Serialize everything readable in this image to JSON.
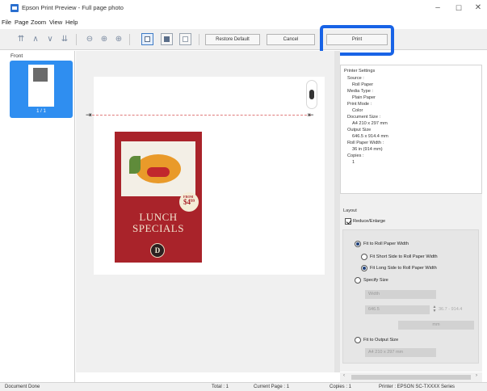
{
  "window": {
    "title": "Epson Print Preview - Full page photo",
    "controls": {
      "minimize": "–",
      "maximize": "☐",
      "close": "✕"
    }
  },
  "menu": {
    "items": [
      "File",
      "Page",
      "Zoom",
      "View",
      "Help"
    ]
  },
  "toolbar": {
    "icons": [
      "first-page-icon",
      "previous-page-icon",
      "next-page-icon",
      "last-page-icon",
      "zoom-out-icon",
      "zoom-actual-icon",
      "zoom-in-icon",
      "full-page-icon",
      "fit-width-icon",
      "blank-page-icon"
    ],
    "restore_default_label": "Restore Default",
    "cancel_label": "Cancel",
    "print_label": "Print"
  },
  "thumbnails": {
    "header": "Front",
    "page_label": "1 / 1"
  },
  "preview": {
    "poster": {
      "line1": "LUNCH",
      "line2": "SPECIALS",
      "price_prefix": "FROM",
      "price": "$4",
      "price_cents": "99",
      "logo_letter": "D"
    }
  },
  "printer_settings": {
    "header": "Printer Settings",
    "source_label": "Source :",
    "source_value": "Roll Paper",
    "media_type_label": "Media Type :",
    "media_type_value": "Plain Paper",
    "print_mode_label": "Print Mode :",
    "print_mode_value": "Color",
    "document_size_label": "Document Size :",
    "document_size_value": "A4 210 x 297 mm",
    "output_size_label": "Output Size",
    "output_size_value": "646.5 x 914.4 mm",
    "roll_width_label": "Roll Paper Width :",
    "roll_width_value": "36 in (914 mm)",
    "copies_label": "Copies :",
    "copies_value": "1"
  },
  "layout": {
    "header": "Layout",
    "reduce_enlarge_label": "Reduce/Enlarge",
    "fit_roll_width_label": "Fit to Roll Paper Width",
    "fit_short_side_label": "Fit Short Side to Roll Paper Width",
    "fit_long_side_label": "Fit Long Side to Roll Paper Width",
    "specify_size_label": "Specify Size",
    "width_field_label": "Width",
    "width_value": "646.5",
    "width_range": "36.7 - 914.4",
    "unit_value": "mm",
    "fit_output_size_label": "Fit to Output Size",
    "output_size_option": "A4 210 x 297 mm"
  },
  "status": {
    "document": "Document Done",
    "total": "Total : 1",
    "current_page": "Current Page : 1",
    "copies": "Copies : 1",
    "printer": "Printer : EPSON SC-TXXXX Series"
  },
  "colors": {
    "accent": "#2f8ef0",
    "highlight_border": "#1863e6",
    "poster_red": "#a9232a"
  }
}
